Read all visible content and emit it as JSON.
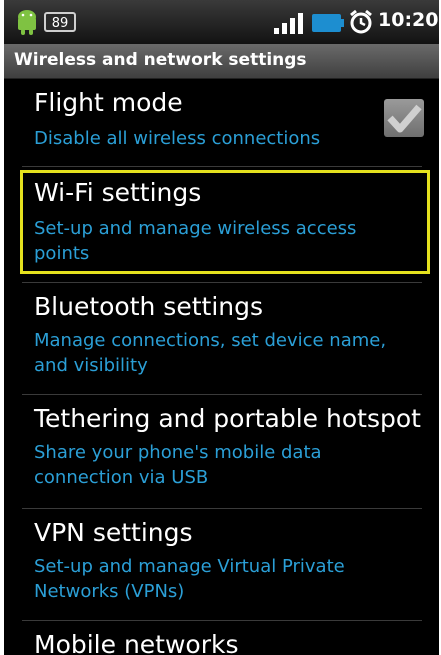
{
  "status_bar": {
    "notification_count": "89",
    "time": "10:20",
    "icons": [
      "android-icon",
      "signal-icon",
      "battery-icon",
      "alarm-icon"
    ]
  },
  "title_bar": {
    "title": "Wireless and network settings"
  },
  "settings": [
    {
      "title": "Flight mode",
      "subtitle": "Disable all wireless connections",
      "checkbox_checked": true
    },
    {
      "title": "Wi-Fi settings",
      "subtitle": "Set-up and manage wireless access points",
      "highlighted": true
    },
    {
      "title": "Bluetooth settings",
      "subtitle": "Manage connections, set device name, and visibility"
    },
    {
      "title": "Tethering and portable hotspot",
      "subtitle": "Share your phone's mobile data connection via USB"
    },
    {
      "title": "VPN settings",
      "subtitle": "Set-up and manage Virtual Private Networks (VPNs)"
    },
    {
      "title": "Mobile networks",
      "subtitle": ""
    }
  ],
  "colors": {
    "accent": "#2b9fd6",
    "highlight": "#e4e11e",
    "background": "#000000"
  }
}
